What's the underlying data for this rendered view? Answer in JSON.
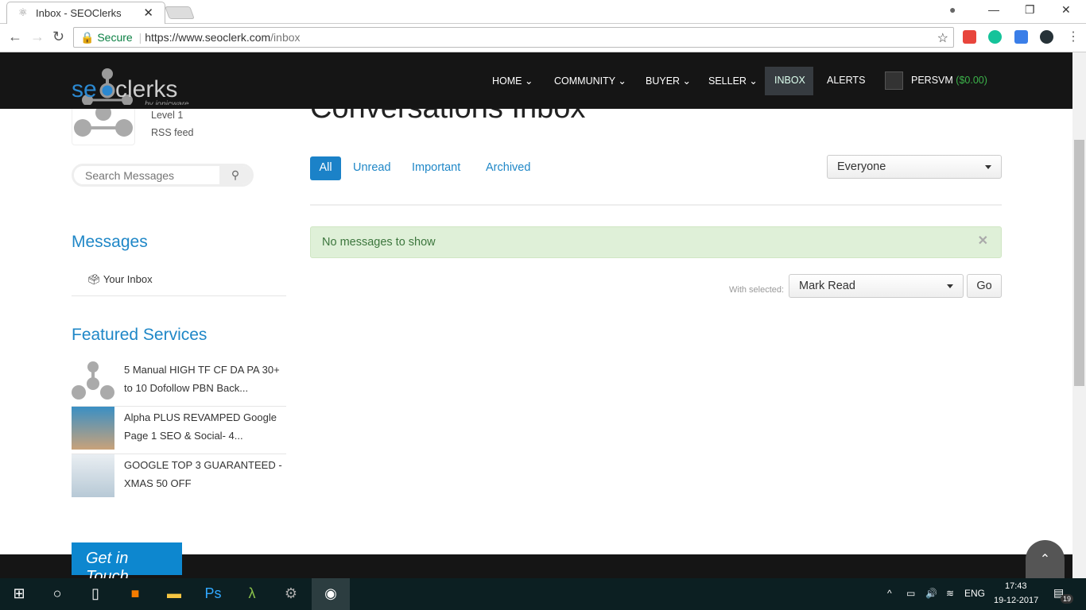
{
  "browser": {
    "tab_title": "Inbox - SEOClerks",
    "secure_label": "Secure",
    "url_host": "https://www.seoclerk.com",
    "url_path": "/inbox"
  },
  "header": {
    "logo_text": "seoclerks",
    "logo_sub": "by ionicware",
    "nav": [
      "HOME",
      "COMMUNITY",
      "BUYER",
      "SELLER",
      "INBOX",
      "ALERTS"
    ],
    "user": "PERSVM",
    "balance": "($0.00)"
  },
  "profile": {
    "level": "Level 1",
    "rss": "RSS feed"
  },
  "search": {
    "placeholder": "Search Messages"
  },
  "page": {
    "title": "Conversations Inbox",
    "filters": [
      "All",
      "Unread",
      "Important",
      "Archived"
    ],
    "recipient_select": "Everyone",
    "alert": "No messages to show",
    "with_selected": "With selected:",
    "bulk_action": "Mark Read",
    "go": "Go"
  },
  "sidebar": {
    "messages_heading": "Messages",
    "your_inbox": "Your Inbox",
    "featured_heading": "Featured Services",
    "featured": [
      {
        "title": "5 Manual HIGH TF CF DA PA 30+ to 10 Dofollow PBN Back..."
      },
      {
        "title": "Alpha PLUS REVAMPED Google Page 1 SEO & Social- 4..."
      },
      {
        "title": "GOOGLE TOP 3 GUARANTEED - XMAS 50 OFF"
      }
    ]
  },
  "footer": {
    "get_in_touch": "Get in Touch"
  },
  "taskbar": {
    "lang": "ENG",
    "time": "17:43",
    "date": "19-12-2017",
    "notifications": "19"
  }
}
